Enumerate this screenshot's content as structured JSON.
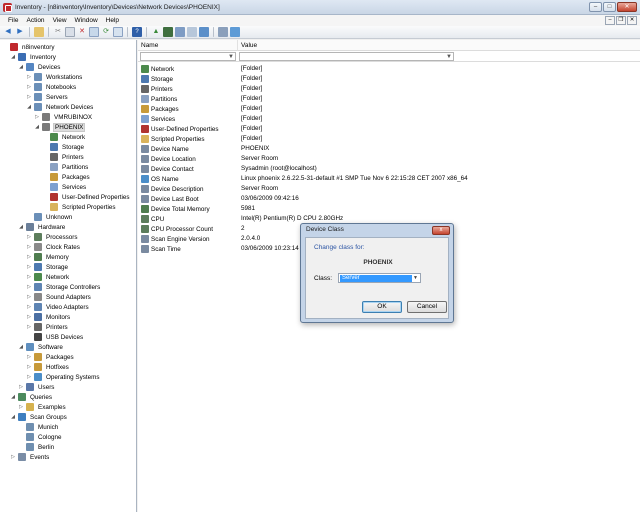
{
  "window": {
    "title": "Inventory - [n8inventory\\Inventory\\Devices\\Network Devices\\PHOENIX]"
  },
  "menu": [
    "File",
    "Action",
    "View",
    "Window",
    "Help"
  ],
  "tree": [
    {
      "label": "n8inventory",
      "indent": 0,
      "exp": "",
      "color": "#c0282d"
    },
    {
      "label": "Inventory",
      "indent": 1,
      "exp": "◢",
      "color": "#3b6db3"
    },
    {
      "label": "Devices",
      "indent": 2,
      "exp": "◢",
      "color": "#5586c2"
    },
    {
      "label": "Workstations",
      "indent": 3,
      "exp": "▷",
      "color": "#6b8fb8"
    },
    {
      "label": "Notebooks",
      "indent": 3,
      "exp": "▷",
      "color": "#6b8fb8"
    },
    {
      "label": "Servers",
      "indent": 3,
      "exp": "▷",
      "color": "#6b8fb8"
    },
    {
      "label": "Network Devices",
      "indent": 3,
      "exp": "◢",
      "color": "#6b8fb8"
    },
    {
      "label": "VMRUBINOX",
      "indent": 4,
      "exp": "▷",
      "color": "#7a7a7a"
    },
    {
      "label": "PHOENIX",
      "indent": 4,
      "exp": "◢",
      "color": "#7a7a7a",
      "selected": true
    },
    {
      "label": "Network",
      "indent": 5,
      "exp": "",
      "color": "#4c8a4c"
    },
    {
      "label": "Storage",
      "indent": 5,
      "exp": "",
      "color": "#4d79b0"
    },
    {
      "label": "Printers",
      "indent": 5,
      "exp": "",
      "color": "#666"
    },
    {
      "label": "Partitions",
      "indent": 5,
      "exp": "",
      "color": "#8aa1c2"
    },
    {
      "label": "Packages",
      "indent": 5,
      "exp": "",
      "color": "#c79a3a"
    },
    {
      "label": "Services",
      "indent": 5,
      "exp": "",
      "color": "#7da0d0"
    },
    {
      "label": "User-Defined Properties",
      "indent": 5,
      "exp": "",
      "color": "#b0332f"
    },
    {
      "label": "Scripted Properties",
      "indent": 5,
      "exp": "",
      "color": "#d9b35c"
    },
    {
      "label": "Unknown",
      "indent": 3,
      "exp": "",
      "color": "#6b8fb8"
    },
    {
      "label": "Hardware",
      "indent": 2,
      "exp": "◢",
      "color": "#6b7f99"
    },
    {
      "label": "Processors",
      "indent": 3,
      "exp": "▷",
      "color": "#5c7d5c"
    },
    {
      "label": "Clock Rates",
      "indent": 3,
      "exp": "▷",
      "color": "#8a8a8a"
    },
    {
      "label": "Memory",
      "indent": 3,
      "exp": "▷",
      "color": "#4f7d4f"
    },
    {
      "label": "Storage",
      "indent": 3,
      "exp": "▷",
      "color": "#4d79b0"
    },
    {
      "label": "Network",
      "indent": 3,
      "exp": "▷",
      "color": "#4c8a4c"
    },
    {
      "label": "Storage Controllers",
      "indent": 3,
      "exp": "▷",
      "color": "#5e84b3"
    },
    {
      "label": "Sound Adapters",
      "indent": 3,
      "exp": "▷",
      "color": "#888"
    },
    {
      "label": "Video Adapters",
      "indent": 3,
      "exp": "▷",
      "color": "#5e84b3"
    },
    {
      "label": "Monitors",
      "indent": 3,
      "exp": "▷",
      "color": "#4b6fa3"
    },
    {
      "label": "Printers",
      "indent": 3,
      "exp": "▷",
      "color": "#666"
    },
    {
      "label": "USB Devices",
      "indent": 3,
      "exp": "",
      "color": "#444"
    },
    {
      "label": "Software",
      "indent": 2,
      "exp": "◢",
      "color": "#5f8fbf"
    },
    {
      "label": "Packages",
      "indent": 3,
      "exp": "▷",
      "color": "#c79a3a"
    },
    {
      "label": "Hotfixes",
      "indent": 3,
      "exp": "▷",
      "color": "#c79a3a"
    },
    {
      "label": "Operating Systems",
      "indent": 3,
      "exp": "▷",
      "color": "#4b8ec9"
    },
    {
      "label": "Users",
      "indent": 2,
      "exp": "▷",
      "color": "#5a77a8"
    },
    {
      "label": "Queries",
      "indent": 1,
      "exp": "◢",
      "color": "#4b8a5e"
    },
    {
      "label": "Examples",
      "indent": 2,
      "exp": "▷",
      "color": "#d6b24f"
    },
    {
      "label": "Scan Groups",
      "indent": 1,
      "exp": "◢",
      "color": "#3f7fbf"
    },
    {
      "label": "Munich",
      "indent": 2,
      "exp": "",
      "color": "#6f8fb0"
    },
    {
      "label": "Cologne",
      "indent": 2,
      "exp": "",
      "color": "#6f8fb0"
    },
    {
      "label": "Berlin",
      "indent": 2,
      "exp": "",
      "color": "#6f8fb0"
    },
    {
      "label": "Events",
      "indent": 1,
      "exp": "▷",
      "color": "#7a8da6"
    }
  ],
  "list": {
    "columns": [
      "Name",
      "Value"
    ],
    "rows": [
      {
        "name": "Network",
        "value": "[Folder]",
        "color": "#4c8a4c"
      },
      {
        "name": "Storage",
        "value": "[Folder]",
        "color": "#4d79b0"
      },
      {
        "name": "Printers",
        "value": "[Folder]",
        "color": "#666"
      },
      {
        "name": "Partitions",
        "value": "[Folder]",
        "color": "#8aa1c2"
      },
      {
        "name": "Packages",
        "value": "[Folder]",
        "color": "#c79a3a"
      },
      {
        "name": "Services",
        "value": "[Folder]",
        "color": "#7da0d0"
      },
      {
        "name": "User-Defined Properties",
        "value": "[Folder]",
        "color": "#b0332f"
      },
      {
        "name": "Scripted Properties",
        "value": "[Folder]",
        "color": "#d9b35c"
      },
      {
        "name": "Device Name",
        "value": "PHOENIX",
        "color": "#7a8aa0"
      },
      {
        "name": "Device Location",
        "value": "Server Room",
        "color": "#7a8aa0"
      },
      {
        "name": "Device Contact",
        "value": "Sysadmin (root@localhost)",
        "color": "#7a8aa0"
      },
      {
        "name": "OS Name",
        "value": "Linux phoenix 2.6.22.5-31-default #1 SMP Tue Nov 6 22:15:28 CET 2007 x86_64",
        "color": "#4b8ec9"
      },
      {
        "name": "Device Description",
        "value": "Server Room",
        "color": "#7a8aa0"
      },
      {
        "name": "Device Last Boot",
        "value": "03/06/2009 09:42:16",
        "color": "#7a8aa0"
      },
      {
        "name": "Device Total Memory",
        "value": "5981",
        "color": "#4f7d4f"
      },
      {
        "name": "CPU",
        "value": "Intel(R) Pentium(R) D CPU 2.80GHz",
        "color": "#5c7d5c"
      },
      {
        "name": "CPU Processor Count",
        "value": "2",
        "color": "#5c7d5c"
      },
      {
        "name": "Scan Engine Version",
        "value": "2.0.4.0",
        "color": "#7a8aa0"
      },
      {
        "name": "Scan Time",
        "value": "03/06/2009 10:23:14",
        "color": "#7a8aa0"
      }
    ]
  },
  "dialog": {
    "title": "Device Class",
    "close": "x",
    "prompt": "Change class for:",
    "device": "PHOENIX",
    "class_label": "Class:",
    "class_value": "Server",
    "ok": "OK",
    "cancel": "Cancel"
  }
}
